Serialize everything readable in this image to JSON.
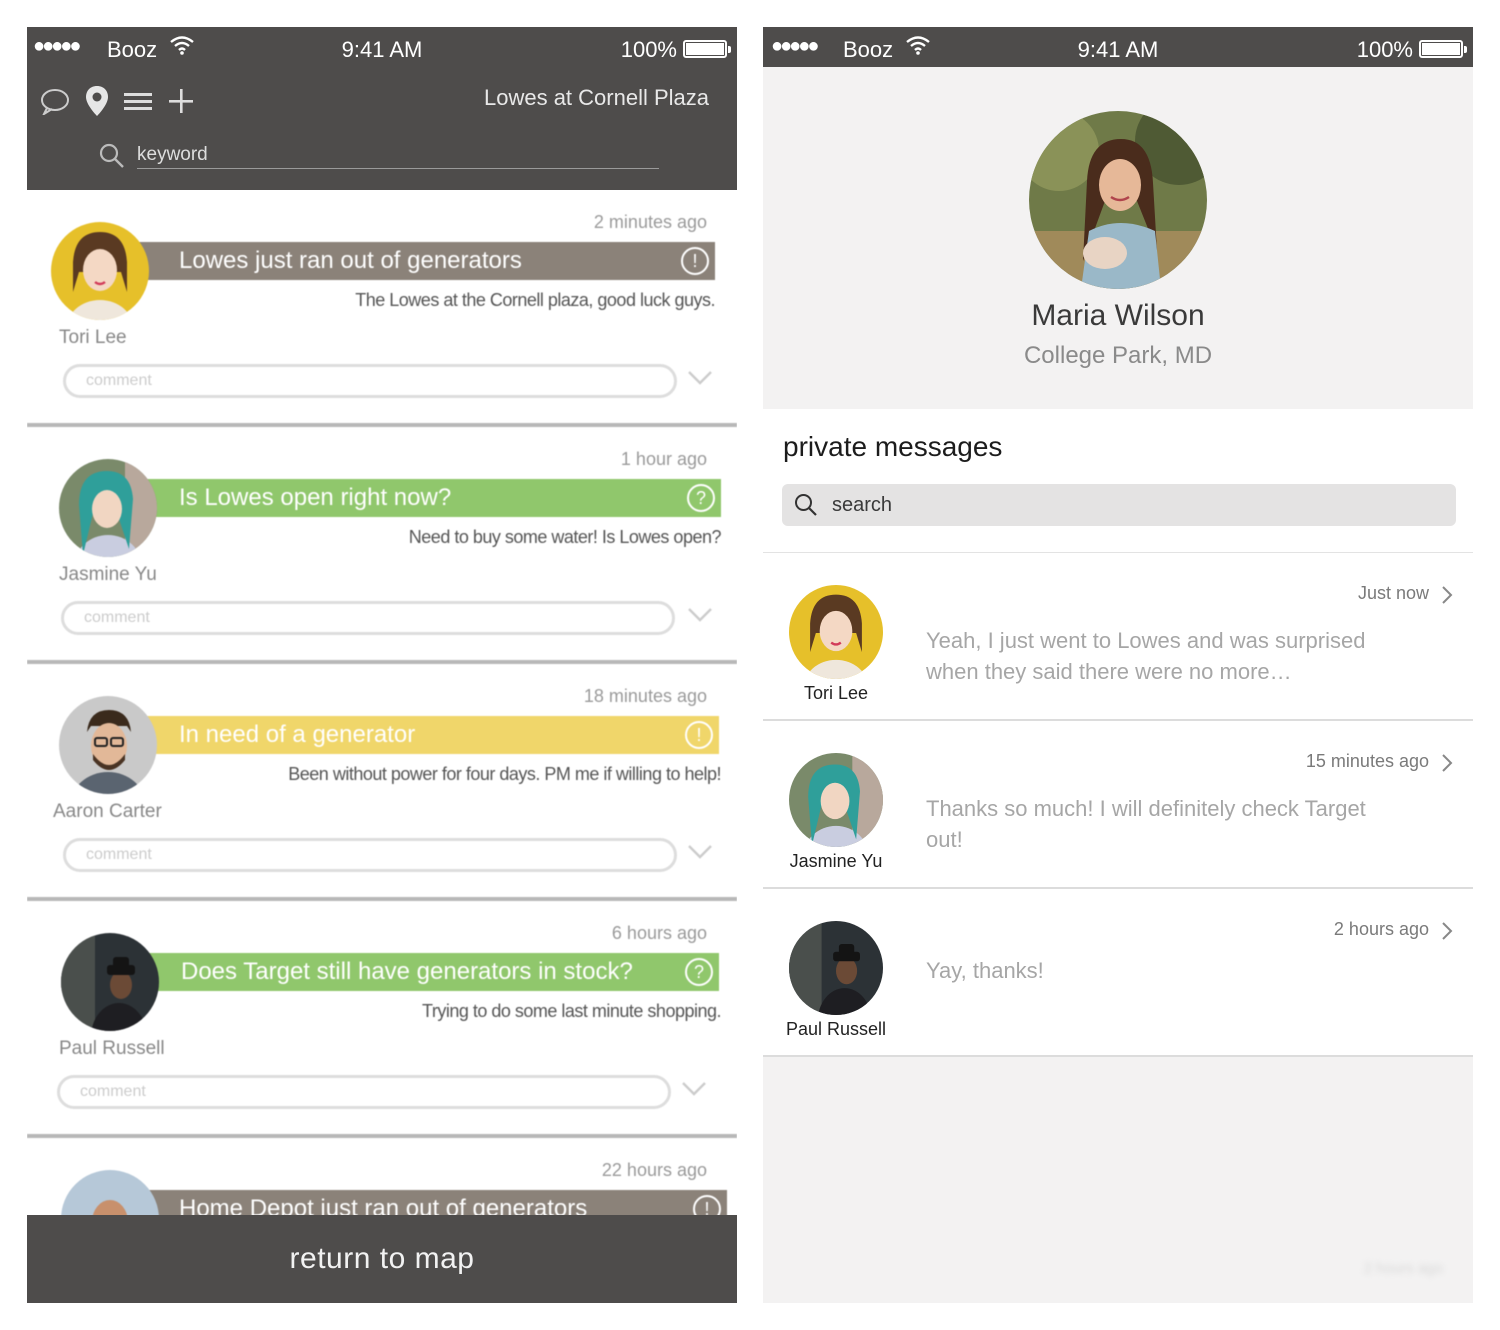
{
  "status": {
    "dots": "●●●●●",
    "carrier": "Booz",
    "time": "9:41 AM",
    "battery": "100%"
  },
  "feed": {
    "location_title": "Lowes at Cornell Plaza",
    "search_placeholder": "keyword",
    "comment_placeholder": "comment",
    "return_label": "return to map",
    "posts": [
      {
        "time": "2 minutes ago",
        "title": "Lowes just ran out of generators",
        "badge": "!",
        "color": "#8b8279",
        "desc": "The Lowes at the Cornell plaza, good luck guys.",
        "author": "Tori Lee"
      },
      {
        "time": "1 hour ago",
        "title": "Is Lowes open right now?",
        "badge": "?",
        "color": "#90c76c",
        "desc": "Need to buy some water! Is Lowes open?",
        "author": "Jasmine Yu"
      },
      {
        "time": "18 minutes ago",
        "title": "In need of a generator",
        "badge": "!",
        "color": "#f0d66a",
        "desc": "Been without power for four days. PM me if willing to help!",
        "author": "Aaron Carter"
      },
      {
        "time": "6 hours ago",
        "title": "Does Target still have generators in stock?",
        "badge": "?",
        "color": "#90c76c",
        "desc": "Trying to do some last minute shopping.",
        "author": "Paul Russell"
      },
      {
        "time": "22 hours ago",
        "title": "Home Depot just ran out of generators",
        "badge": "!",
        "color": "#8b8279",
        "desc": "",
        "author": ""
      }
    ]
  },
  "profile": {
    "name": "Maria Wilson",
    "location": "College Park, MD",
    "pm_title": "private messages",
    "search_placeholder": "search",
    "threads": [
      {
        "name": "Tori Lee",
        "time": "Just now",
        "preview": "Yeah, I just went to Lowes and was surprised when they said there were no more…"
      },
      {
        "name": "Jasmine Yu",
        "time": "15 minutes ago",
        "preview": "Thanks so much! I will definitely check Target out!"
      },
      {
        "name": "Paul Russell",
        "time": "2 hours ago",
        "preview": "Yay, thanks!"
      }
    ],
    "footer_faded": "2 hours ago"
  },
  "colors": {
    "header_bg": "#4e4c4b",
    "accent_green": "#90c76c",
    "accent_yellow": "#f0d66a",
    "accent_taupe": "#8b8279"
  }
}
